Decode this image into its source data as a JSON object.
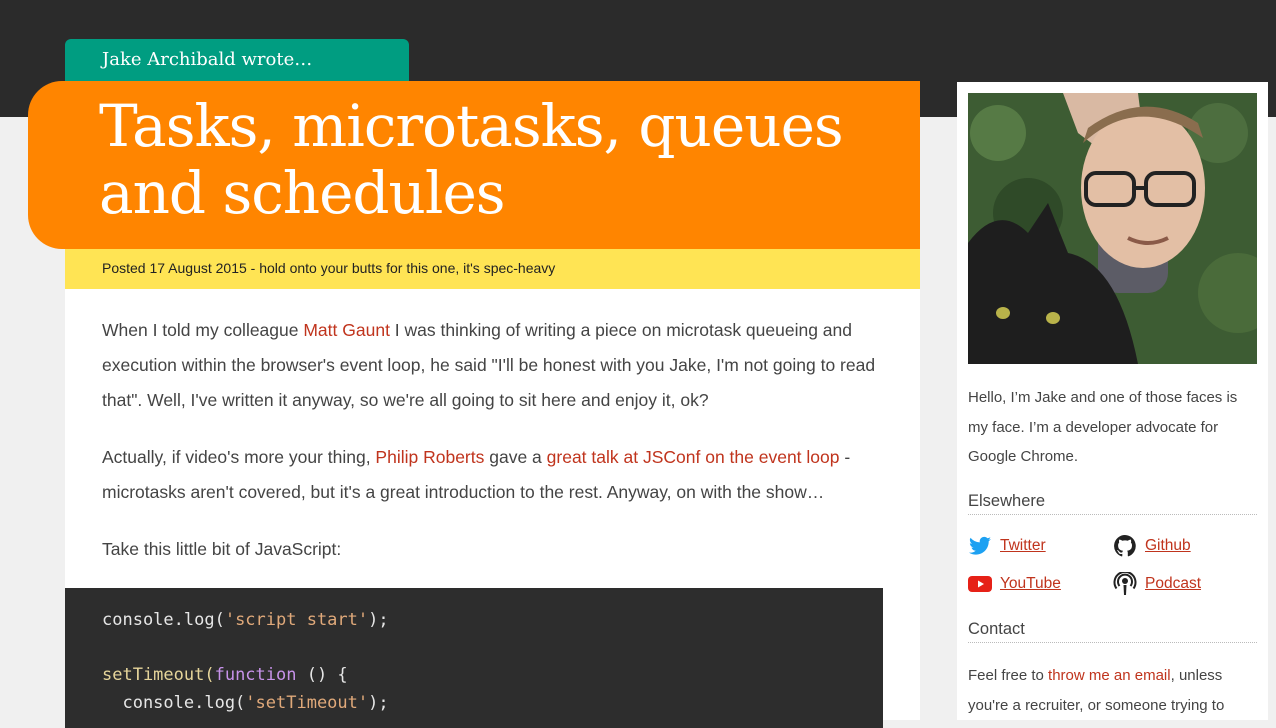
{
  "header": {
    "author_line": "Jake Archibald wrote…",
    "title_line1": "Tasks, microtasks, queues",
    "title_line2": "and schedules",
    "meta": "Posted 17 August 2015 - hold onto your butts for this one, it's spec-heavy"
  },
  "article": {
    "p1": {
      "t1": "When I told my colleague ",
      "link1": "Matt Gaunt",
      "t2": " I was thinking of writing a piece on microtask queueing and execution within the browser's event loop, he said \"I'll be honest with you Jake, I'm not going to read that\". Well, I've written it anyway, so we're all going to sit here and enjoy it, ok?"
    },
    "p2": {
      "t1": "Actually, if video's more your thing, ",
      "link1": "Philip Roberts",
      "t2": " gave a ",
      "link2": "great talk at JSConf on the event loop",
      "t3": " - microtasks aren't covered, but it's a great introduction to the rest. Anyway, on with the show…"
    },
    "p3": "Take this little bit of JavaScript:",
    "code": {
      "l1_a": "console.log(",
      "l1_str": "'script start'",
      "l1_b": ");",
      "l3_a": "setTimeout(",
      "l3_kw": "function",
      "l3_b": " () {",
      "l4_a": "  console.log(",
      "l4_str": "'setTimeout'",
      "l4_b": ");"
    }
  },
  "sidebar": {
    "bio": "Hello, I’m Jake and one of those faces is my face. I’m a developer advocate for Google Chrome.",
    "elsewhere_heading": "Elsewhere",
    "links": {
      "twitter": "Twitter",
      "github": "Github",
      "youtube": "YouTube",
      "podcast": "Podcast"
    },
    "contact_heading": "Contact",
    "contact": {
      "t1": "Feel free to ",
      "link": "throw me an email",
      "t2": ", unless you're a recruiter, or someone trying to"
    }
  },
  "colors": {
    "topband": "#2b2b2b",
    "author_tab": "#009d81",
    "title_bg": "#ff8500",
    "meta_bg": "#ffe454",
    "link": "#c0341d"
  }
}
